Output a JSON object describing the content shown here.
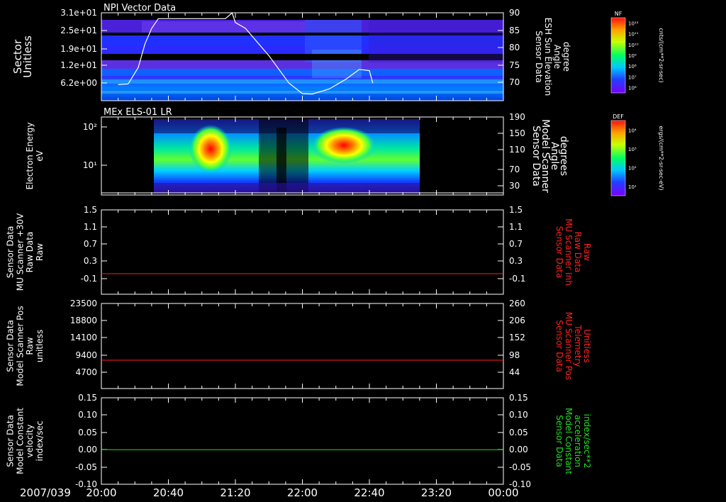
{
  "date_label": "2007/039",
  "x_tick_labels": [
    "20:00",
    "20:40",
    "21:20",
    "22:00",
    "22:40",
    "23:20",
    "00:00"
  ],
  "colors": {
    "red": "#ff2020",
    "green": "#20e020",
    "white": "#ffffff",
    "axis": "#ffffff"
  },
  "chart_data": [
    {
      "type": "heatmap",
      "title": "NPI Vector Data",
      "y_tick_labels": [
        "3.1e+01",
        "2.5e+01",
        "1.9e+01",
        "1.2e+01",
        "6.2e+00"
      ],
      "ylabel_left": [
        "Sector",
        "Unitless"
      ],
      "y2_tick_labels": [
        "90",
        "85",
        "80",
        "75",
        "70"
      ],
      "ylabel_right": [
        "Sensor Data",
        "ESH Sun Elevation",
        "Angle",
        "degree"
      ],
      "colorbar": {
        "label": "NF",
        "ticks": [
          "10¹²",
          "10¹¹",
          "10¹⁰",
          "10⁹",
          "10⁸",
          "10⁷",
          "10⁶"
        ],
        "units": "cnts/(cm**2-sr-sec)"
      },
      "overlay_line": {
        "name": "ESH Sun Elevation Angle",
        "x": [
          "20:10",
          "20:16",
          "20:22",
          "20:26",
          "20:30",
          "20:34",
          "20:40",
          "21:00",
          "21:14",
          "21:16",
          "21:18",
          "21:20",
          "21:26",
          "21:40",
          "21:52",
          "22:00",
          "22:06",
          "22:16",
          "22:26",
          "22:34",
          "22:40",
          "22:42"
        ],
        "y": [
          71.6,
          71.8,
          76,
          82,
          86,
          88.5,
          88.5,
          88.5,
          88.5,
          89.2,
          90,
          87.5,
          86,
          79,
          72,
          69.3,
          69.2,
          70.5,
          73,
          75.5,
          75.2,
          72
        ]
      }
    },
    {
      "type": "heatmap",
      "title": "MEx ELS-01 LR",
      "y_tick_labels": [
        "10²",
        "10¹"
      ],
      "ylabel_left": [
        "Electron Energy",
        "eV"
      ],
      "y2_tick_labels": [
        "190",
        "150",
        "110",
        "70",
        "30"
      ],
      "ylabel_right": [
        "Sensor Data",
        "Model Scanner",
        "Angle",
        "degrees"
      ],
      "colorbar": {
        "label": "DEF",
        "ticks": [
          "10⁴",
          "10³",
          "10²",
          "10¹"
        ],
        "units": "ergs/(cm**2-sr-sec-eV)"
      },
      "overlay_line": {
        "name": "Model Scanner Angle",
        "x": [
          "20:00",
          "00:00"
        ],
        "y": [
          15,
          15
        ]
      }
    },
    {
      "type": "line",
      "y_tick_labels": [
        "1.5",
        "1.1",
        "0.7",
        "0.3",
        "-0.1"
      ],
      "ylabel_left": [
        "Sensor Data",
        "MU Scanner +30V",
        "Raw Data",
        "Raw"
      ],
      "ylim": [
        -0.3,
        1.5
      ],
      "y2_tick_labels": [
        "1.5",
        "1.1",
        "0.7",
        "0.3",
        "-0.1"
      ],
      "ylabel_right": [
        "Sensor Data",
        "MU Scanner Inh",
        "Raw Data",
        "Raw"
      ],
      "series": [
        {
          "x": [
            "20:00",
            "00:00"
          ],
          "y": [
            0.0,
            0.0
          ],
          "color": "#ff2020"
        }
      ]
    },
    {
      "type": "line",
      "y_tick_labels": [
        "23500",
        "18800",
        "14100",
        "9400",
        "4700"
      ],
      "ylabel_left": [
        "Sensor Data",
        "Model Scanner Pos",
        "Raw",
        "unitless"
      ],
      "ylim": [
        0,
        23500
      ],
      "y2_tick_labels": [
        "260",
        "206",
        "152",
        "98",
        "44"
      ],
      "ylabel_right": [
        "Sensor Data",
        "MU Scanner Pos",
        "Telemetry",
        "Unitless"
      ],
      "series": [
        {
          "x": [
            "20:00",
            "00:00"
          ],
          "y": [
            8600,
            8600
          ],
          "color": "#ff2020"
        }
      ]
    },
    {
      "type": "line",
      "y_tick_labels": [
        "0.15",
        "0.10",
        "0.05",
        "0.00",
        "-0.05",
        "-0.10"
      ],
      "ylabel_left": [
        "Sensor Data",
        "Model Constant",
        "velocity",
        "index/sec"
      ],
      "ylim": [
        -0.1,
        0.15
      ],
      "y2_tick_labels": [
        "0.15",
        "0.10",
        "0.05",
        "0.00",
        "-0.05",
        "-0.10"
      ],
      "ylabel_right": [
        "Sensor Data",
        "Model Constant",
        "acceleration",
        "index/sec**2"
      ],
      "series": [
        {
          "x": [
            "20:00",
            "00:00"
          ],
          "y": [
            0.0,
            0.0
          ],
          "color": "#20e020"
        }
      ]
    }
  ]
}
